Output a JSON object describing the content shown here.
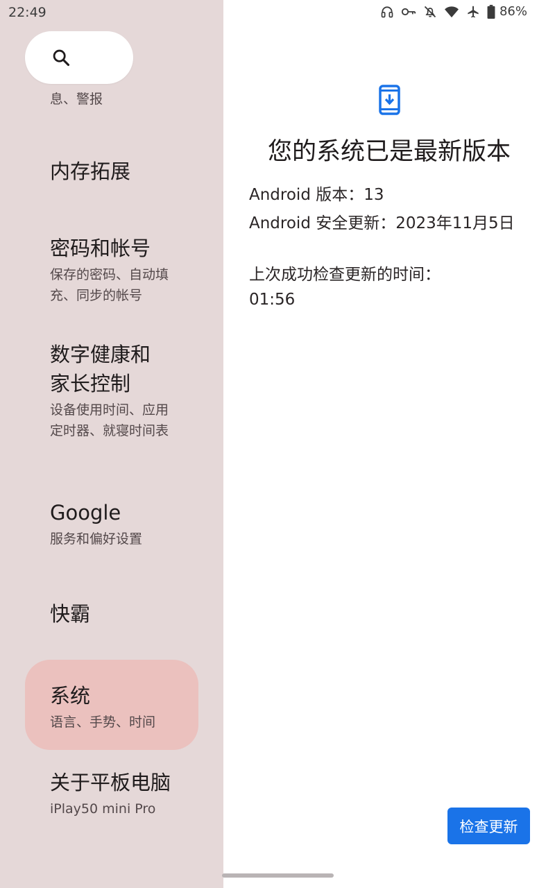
{
  "status_bar": {
    "time": "22:49",
    "battery": "86%",
    "icons": [
      "headphones-icon",
      "key-icon",
      "notifications-off-icon",
      "wifi-icon",
      "airplane-icon",
      "battery-icon"
    ]
  },
  "search": {
    "icon": "search-icon"
  },
  "nav": {
    "partial_item": {
      "subtitle": "息、警报"
    },
    "items": [
      {
        "title": "内存拓展",
        "subtitle": ""
      },
      {
        "title": "密码和帐号",
        "subtitle": "保存的密码、自动填充、同步的帐号"
      },
      {
        "title": "数字健康和家长控制",
        "subtitle": "设备使用时间、应用定时器、就寝时间表"
      },
      {
        "title": "Google",
        "subtitle": "服务和偏好设置"
      },
      {
        "title": "快霸",
        "subtitle": ""
      },
      {
        "title": "系统",
        "subtitle": "语言、手势、时间",
        "selected": true
      },
      {
        "title": "关于平板电脑",
        "subtitle": "iPlay50 mini Pro"
      }
    ]
  },
  "update_panel": {
    "icon": "system-update-icon",
    "title": "您的系统已是最新版本",
    "android_version": "Android 版本：13",
    "security_update": "Android 安全更新：2023年11月5日",
    "last_check_label": "上次成功检查更新的时间：",
    "last_check_time": "01:56",
    "check_button": "检查更新"
  },
  "colors": {
    "left_pane_bg": "#e5d8d8",
    "selected_bg": "#ebc1be",
    "accent": "#1a73e8"
  }
}
